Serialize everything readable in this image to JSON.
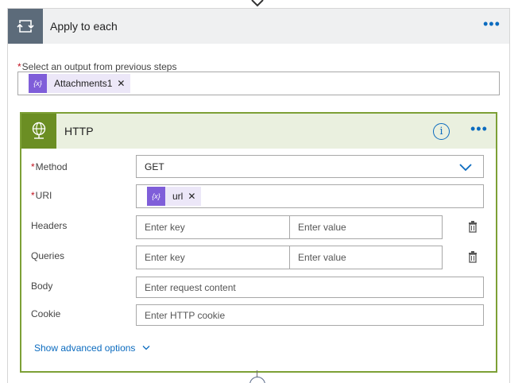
{
  "loop": {
    "title": "Apply to each",
    "select_label": "Select an output from previous steps",
    "token_label": "Attachments1",
    "token_icon": "{x}"
  },
  "http": {
    "title": "HTTP",
    "method_label": "Method",
    "method_value": "GET",
    "uri_label": "URI",
    "uri_token": "url",
    "uri_token_icon": "{x}",
    "headers_label": "Headers",
    "headers_key_placeholder": "Enter key",
    "headers_value_placeholder": "Enter value",
    "queries_label": "Queries",
    "queries_key_placeholder": "Enter key",
    "queries_value_placeholder": "Enter value",
    "body_label": "Body",
    "body_placeholder": "Enter request content",
    "cookie_label": "Cookie",
    "cookie_placeholder": "Enter HTTP cookie",
    "advanced_link": "Show advanced options"
  },
  "icons": {
    "loop": "loop-icon",
    "http": "globe-icon",
    "info": "info-icon",
    "more": "more-dots-icon",
    "delete": "delete-icon",
    "chevron": "chevron-down-icon"
  },
  "colors": {
    "accent": "#0b6bbf",
    "http_brand": "#6b8e23",
    "loop_brand": "#5c6b7a",
    "token": "#7f5ed9",
    "required": "#c1121f"
  }
}
